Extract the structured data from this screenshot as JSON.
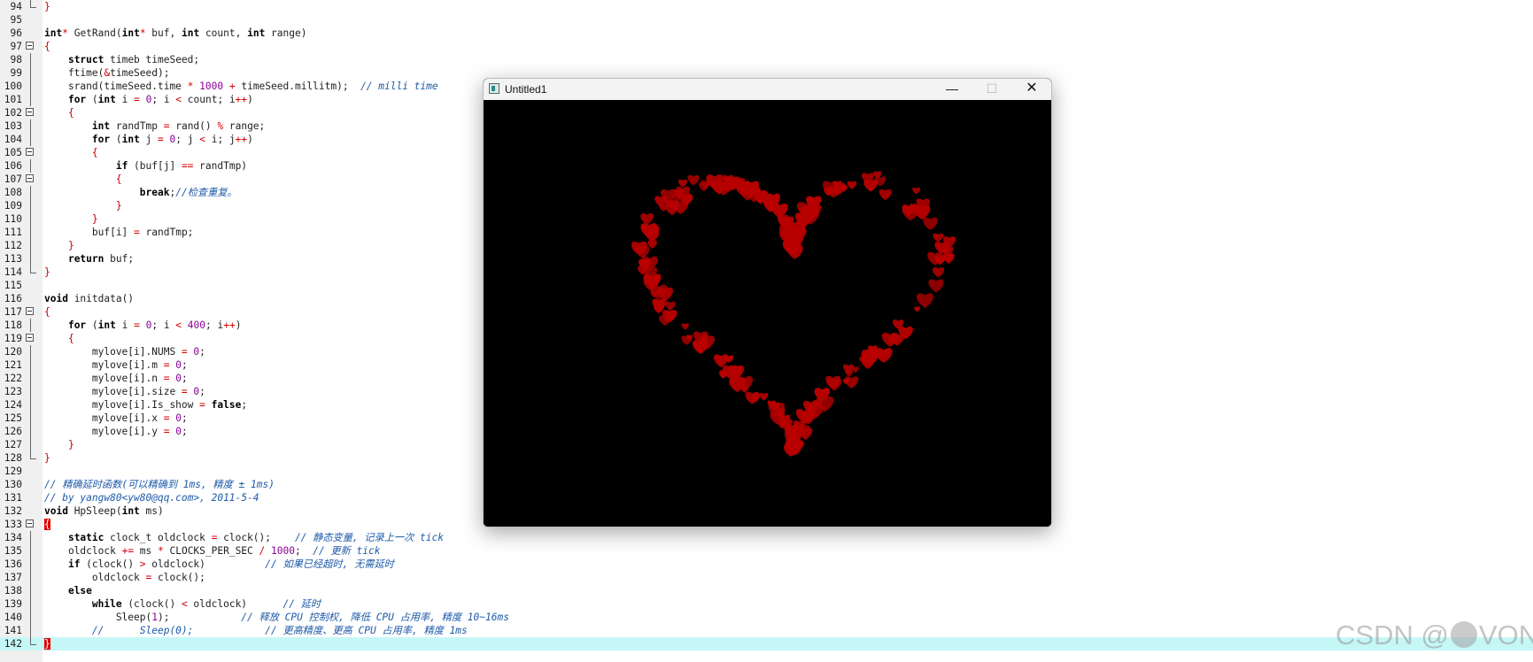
{
  "editor": {
    "lines": [
      {
        "n": "94",
        "t": "}",
        "fold": "end",
        "depth": 0
      },
      {
        "n": "95",
        "t": "",
        "depth": 0
      },
      {
        "n": "96",
        "t": "int* GetRand(int* buf, int count, int range)",
        "depth": 0
      },
      {
        "n": "97",
        "t": "{",
        "fold": "start",
        "depth": 0
      },
      {
        "n": "98",
        "t": "    struct timeb timeSeed;",
        "depth": 1
      },
      {
        "n": "99",
        "t": "    ftime(&timeSeed);",
        "depth": 1
      },
      {
        "n": "100",
        "t": "    srand(timeSeed.time * 1000 + timeSeed.millitm);  // milli time",
        "depth": 1
      },
      {
        "n": "101",
        "t": "    for (int i = 0; i < count; i++)",
        "depth": 1
      },
      {
        "n": "102",
        "t": "    {",
        "fold": "start",
        "depth": 1
      },
      {
        "n": "103",
        "t": "        int randTmp = rand() % range;",
        "depth": 2
      },
      {
        "n": "104",
        "t": "        for (int j = 0; j < i; j++)",
        "depth": 2
      },
      {
        "n": "105",
        "t": "        {",
        "fold": "start",
        "depth": 2
      },
      {
        "n": "106",
        "t": "            if (buf[j] == randTmp)",
        "depth": 3
      },
      {
        "n": "107",
        "t": "            {",
        "fold": "start",
        "depth": 3
      },
      {
        "n": "108",
        "t": "                break;//检查重复。",
        "depth": 4
      },
      {
        "n": "109",
        "t": "            }",
        "depth": 3
      },
      {
        "n": "110",
        "t": "        }",
        "depth": 2
      },
      {
        "n": "111",
        "t": "        buf[i] = randTmp;",
        "depth": 2
      },
      {
        "n": "112",
        "t": "    }",
        "depth": 1
      },
      {
        "n": "113",
        "t": "    return buf;",
        "depth": 1
      },
      {
        "n": "114",
        "t": "}",
        "fold": "end",
        "depth": 0
      },
      {
        "n": "115",
        "t": "",
        "depth": 0
      },
      {
        "n": "116",
        "t": "void initdata()",
        "depth": 0
      },
      {
        "n": "117",
        "t": "{",
        "fold": "start",
        "depth": 0
      },
      {
        "n": "118",
        "t": "    for (int i = 0; i < 400; i++)",
        "depth": 1
      },
      {
        "n": "119",
        "t": "    {",
        "fold": "start",
        "depth": 1
      },
      {
        "n": "120",
        "t": "        mylove[i].NUMS = 0;",
        "depth": 2
      },
      {
        "n": "121",
        "t": "        mylove[i].m = 0;",
        "depth": 2
      },
      {
        "n": "122",
        "t": "        mylove[i].n = 0;",
        "depth": 2
      },
      {
        "n": "123",
        "t": "        mylove[i].size = 0;",
        "depth": 2
      },
      {
        "n": "124",
        "t": "        mylove[i].Is_show = false;",
        "depth": 2
      },
      {
        "n": "125",
        "t": "        mylove[i].x = 0;",
        "depth": 2
      },
      {
        "n": "126",
        "t": "        mylove[i].y = 0;",
        "depth": 2
      },
      {
        "n": "127",
        "t": "    }",
        "depth": 1
      },
      {
        "n": "128",
        "t": "}",
        "fold": "end",
        "depth": 0
      },
      {
        "n": "129",
        "t": "",
        "depth": 0
      },
      {
        "n": "130",
        "t": "// 精确延时函数(可以精确到 1ms, 精度 ± 1ms)",
        "depth": 0
      },
      {
        "n": "131",
        "t": "// by yangw80<yw80@qq.com>, 2011-5-4",
        "depth": 0
      },
      {
        "n": "132",
        "t": "void HpSleep(int ms)",
        "depth": 0
      },
      {
        "n": "133",
        "t": "{",
        "fold": "start",
        "depth": 0,
        "cursorBrace": true
      },
      {
        "n": "134",
        "t": "    static clock_t oldclock = clock();    // 静态变量, 记录上一次 tick",
        "depth": 1
      },
      {
        "n": "135",
        "t": "    oldclock += ms * CLOCKS_PER_SEC / 1000;  // 更新 tick",
        "depth": 1
      },
      {
        "n": "136",
        "t": "    if (clock() > oldclock)          // 如果已经超时, 无需延时",
        "depth": 1
      },
      {
        "n": "137",
        "t": "        oldclock = clock();",
        "depth": 2
      },
      {
        "n": "138",
        "t": "    else",
        "depth": 1
      },
      {
        "n": "139",
        "t": "        while (clock() < oldclock)      // 延时",
        "depth": 2
      },
      {
        "n": "140",
        "t": "            Sleep(1);            // 释放 CPU 控制权, 降低 CPU 占用率, 精度 10~16ms",
        "depth": 3
      },
      {
        "n": "141",
        "t": "        //      Sleep(0);            // 更高精度、更高 CPU 占用率, 精度 1ms",
        "depth": 2
      },
      {
        "n": "142",
        "t": "}",
        "fold": "end",
        "depth": 0,
        "current": true,
        "cursorBrace": true
      }
    ]
  },
  "window": {
    "title": "Untitled1",
    "minimize": "—",
    "maximize": "☐",
    "close": "✕"
  },
  "heart": {
    "color": "#b80000",
    "count": 230
  },
  "watermark": {
    "prefix": "CSDN @",
    "suffix": "VON"
  }
}
